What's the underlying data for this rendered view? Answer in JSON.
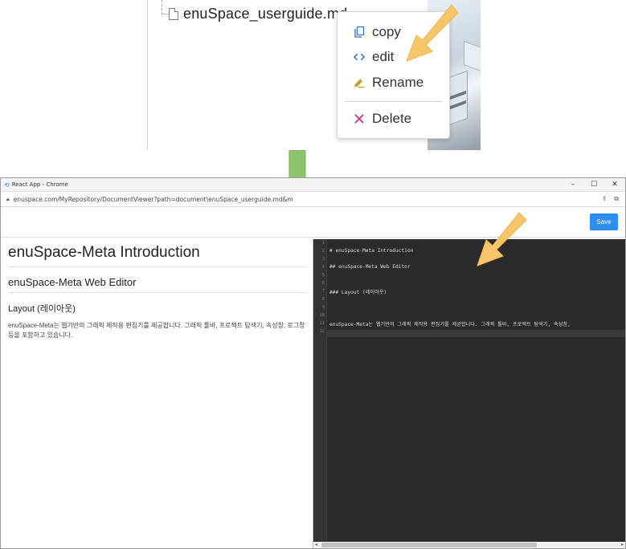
{
  "file_tree": {
    "file_name": "enuSpace_userguide.md"
  },
  "context_menu": {
    "items": [
      {
        "label": "copy",
        "icon": "copy-icon"
      },
      {
        "label": "edit",
        "icon": "code-icon"
      },
      {
        "label": "Rename",
        "icon": "pencil-icon"
      },
      {
        "label": "Delete",
        "icon": "close-icon"
      }
    ]
  },
  "browser": {
    "window_title": "React App - Chrome",
    "url": "enuspace.com/MyRepository/DocumentViewer?path=document\\enuSpace_userguide.md&m",
    "save_label": "Save"
  },
  "preview": {
    "h1": "enuSpace-Meta Introduction",
    "h2": "enuSpace-Meta Web Editor",
    "h3": "Layout (레이아웃)",
    "paragraph": "enuSpace-Meta는 웹기반의 그래픽 제작용 편집기를 제공합니다. 그래픽 툴바, 프로젝트 탐색기, 속성창, 로그창 등을 포함하고 있습니다."
  },
  "editor": {
    "line_numbers": [
      "1",
      "2",
      "3",
      "4",
      "5",
      "6",
      "7",
      "8",
      "9",
      "10",
      "11",
      "12"
    ],
    "lines": [
      {
        "n": 2,
        "text": "# enuSpace-Meta Introduction"
      },
      {
        "n": 4,
        "text": "## enuSpace-Meta Web Editor"
      },
      {
        "n": 7,
        "text": "### Layout (레이아웃)"
      },
      {
        "n": 11,
        "text": "enuSpace-Meta는 웹기반의 그래픽 제작용 편집기를 제공합니다. 그래픽 툴바, 프로젝트 탐색기, 속성창,"
      }
    ]
  },
  "colors": {
    "save_button": "#2b8ef0",
    "editor_bg": "#2b2b2b",
    "arrow_yellow": "#f7c56a",
    "arrow_green": "#8cc36b"
  }
}
